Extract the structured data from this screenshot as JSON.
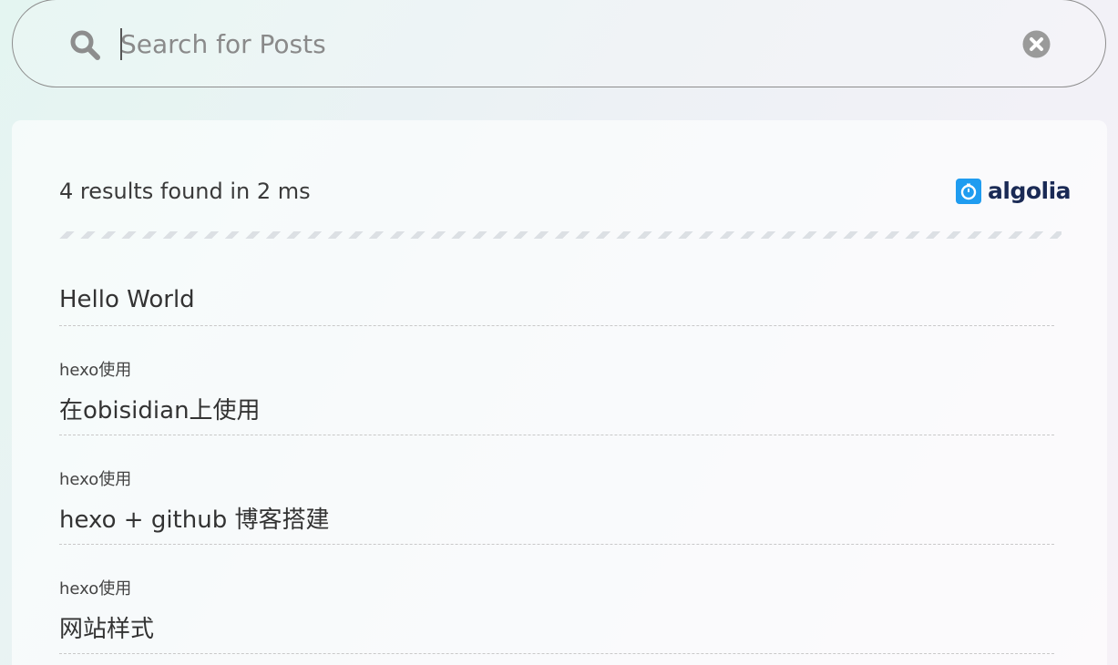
{
  "search": {
    "placeholder": "Search for Posts",
    "value": ""
  },
  "results": {
    "stats": "4 results found in 2 ms",
    "provider": "algolia",
    "items": [
      {
        "category": "",
        "title": "Hello World"
      },
      {
        "category": "hexo使用",
        "title": "在obisidian上使用"
      },
      {
        "category": "hexo使用",
        "title": "hexo + github 博客搭建"
      },
      {
        "category": "hexo使用",
        "title": "网站样式"
      }
    ]
  },
  "icons": {
    "search": "search-icon",
    "clear": "close-circle-icon",
    "algolia": "algolia-logo-icon"
  },
  "colors": {
    "algolia_blue": "#1f9cf0",
    "algolia_text": "#1a2a55",
    "text_primary": "#333333",
    "placeholder": "#8a8a8a"
  }
}
